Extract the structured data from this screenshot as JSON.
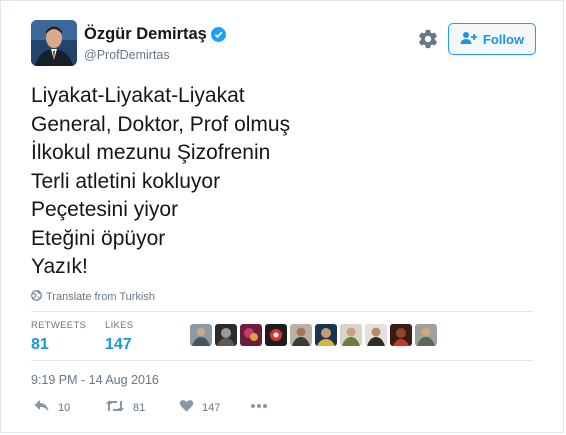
{
  "user": {
    "display_name": "Özgür Demirtaş",
    "handle": "@ProfDemirtas",
    "verified": true,
    "avatar_icon": "profile-photo"
  },
  "header": {
    "settings_icon": "gear-icon",
    "follow_label": "Follow",
    "follow_icon": "add-person-icon"
  },
  "tweet": {
    "lines": [
      "Liyakat-Liyakat-Liyakat",
      "General, Doktor, Prof olmuş",
      "İlkokul mezunu Şizofrenin",
      "Terli atletini kokluyor",
      "Peçetesini yiyor",
      "Eteğini öpüyor",
      "Yazık!"
    ],
    "translate_label": "Translate from Turkish"
  },
  "stats": {
    "retweets_label": "RETWEETS",
    "retweets_value": "81",
    "likes_label": "LIKES",
    "likes_value": "147"
  },
  "timestamp": "9:19 PM - 14 Aug 2016",
  "actions": {
    "reply_count": "10",
    "retweet_count": "81",
    "like_count": "147"
  },
  "colors": {
    "accent": "#1da1f2",
    "link": "#1b95e0",
    "muted": "#657786",
    "border": "#e1e8ed"
  }
}
